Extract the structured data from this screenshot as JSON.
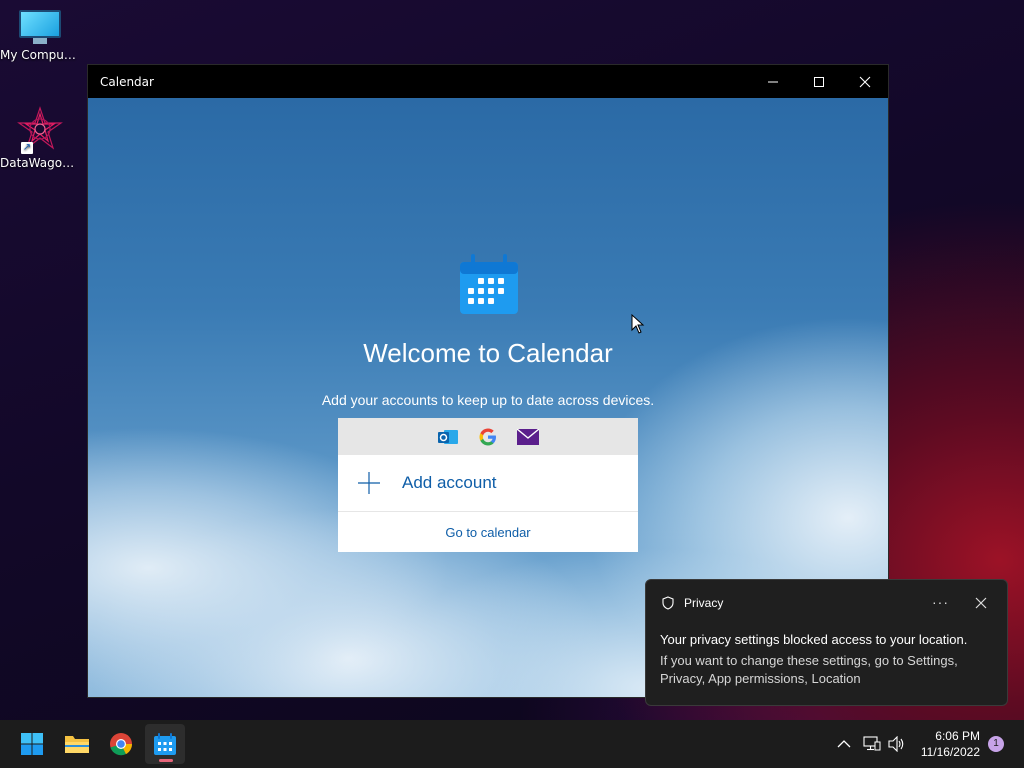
{
  "desktop": {
    "icons": [
      {
        "label": "My Computer"
      },
      {
        "label": "DataWagon..."
      }
    ]
  },
  "calendar_window": {
    "title": "Calendar",
    "welcome_title": "Welcome to Calendar",
    "welcome_subtitle": "Add your accounts to keep up to date across devices.",
    "providers": [
      "outlook-icon",
      "google-icon",
      "mail-icon"
    ],
    "add_account_label": "Add account",
    "go_to_calendar_label": "Go to calendar"
  },
  "toast": {
    "header": "Privacy",
    "more_label": "···",
    "line1": "Your privacy settings blocked access to your location.",
    "line2": "If you want to change these settings, go to Settings, Privacy, App permissions, Location"
  },
  "taskbar": {
    "time": "6:06 PM",
    "date": "11/16/2022",
    "notification_count": "1",
    "accent_color": "#e7657a"
  }
}
